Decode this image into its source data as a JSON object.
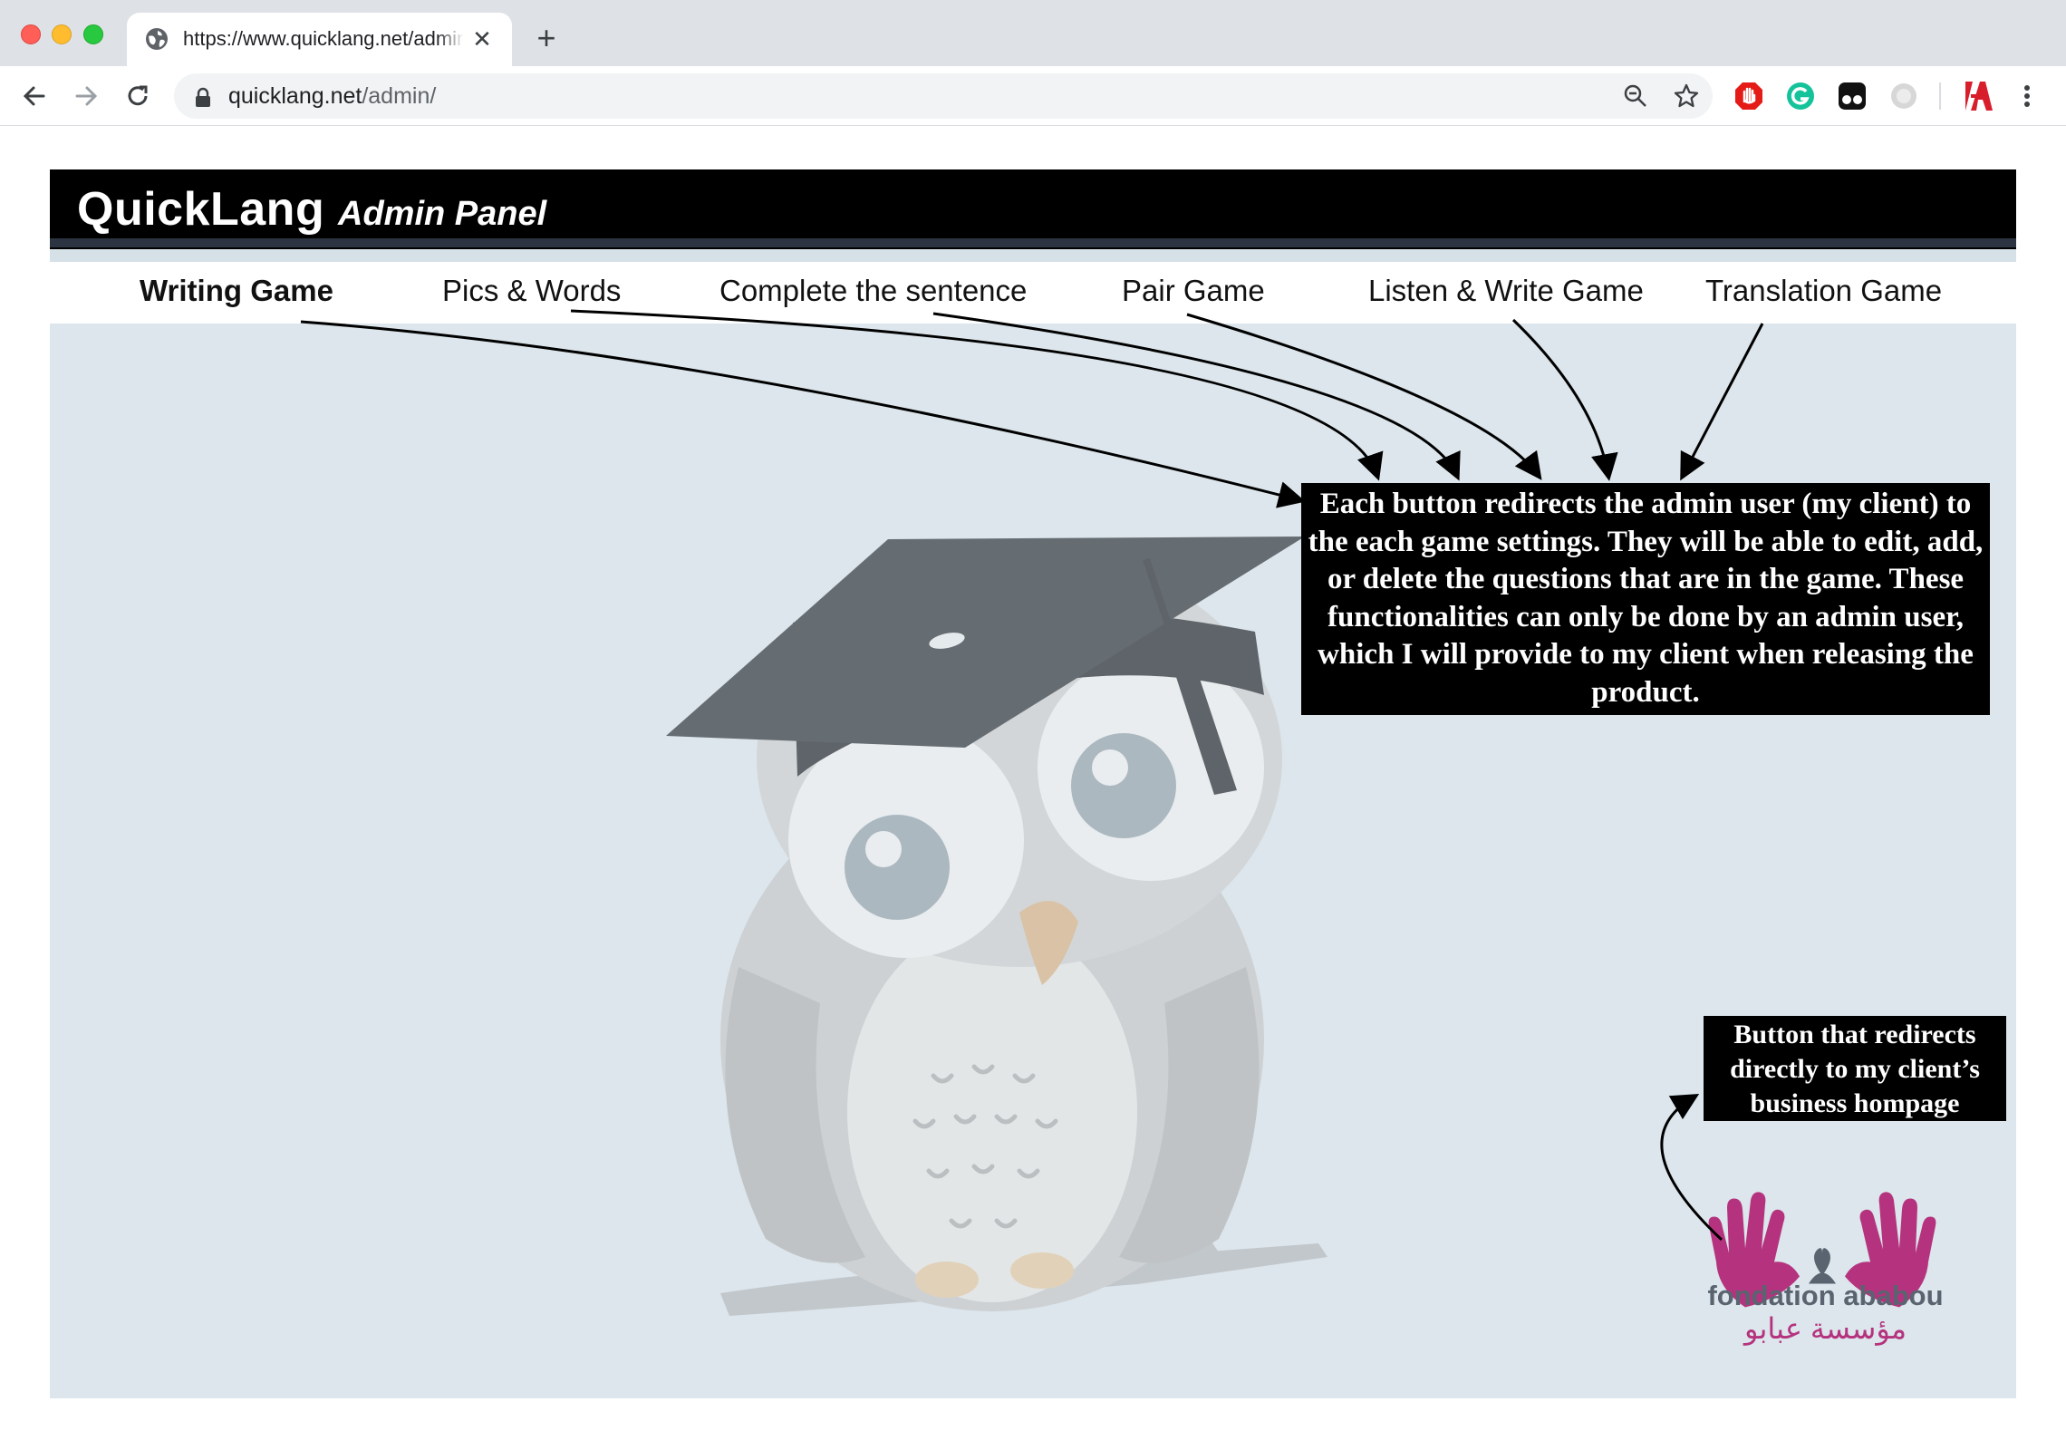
{
  "browser": {
    "tab_title": "https://www.quicklang.net/admin/",
    "tab_close": "✕",
    "new_tab": "+",
    "url_host": "quicklang.net",
    "url_path": "/admin/"
  },
  "header": {
    "brand": "QuickLang",
    "panel_title": "Admin Panel"
  },
  "nav": {
    "items": [
      {
        "label": "Writing Game",
        "active": true
      },
      {
        "label": "Pics & Words"
      },
      {
        "label": "Complete the sentence"
      },
      {
        "label": "Pair Game"
      },
      {
        "label": "Listen & Write Game"
      },
      {
        "label": "Translation Game"
      }
    ]
  },
  "annotations": {
    "main": "Each button redirects the admin user (my client) to the each game settings. They will be able to edit, add, or delete the questions that are in the game. These functionalities can only be done by an admin user, which I will provide to my client when releasing the product.",
    "logo": "Button that redirects directly to my client’s business hompage"
  },
  "logo": {
    "name": "fondation ababou",
    "arabic": "مؤسسة عبابو",
    "color": "#b5337e"
  },
  "colors": {
    "header_bg": "#000000",
    "content_bg": "#dce6ec",
    "annotation_bg": "#000000"
  },
  "icons": [
    "globe-icon",
    "back-icon",
    "forward-icon",
    "reload-icon",
    "lock-icon",
    "zoom-icon",
    "star-icon",
    "adblock-icon",
    "grammarly-icon",
    "tampermonkey-icon",
    "extension-icon",
    "translate-icon",
    "menu-icon",
    "owl-mascot-icon"
  ]
}
